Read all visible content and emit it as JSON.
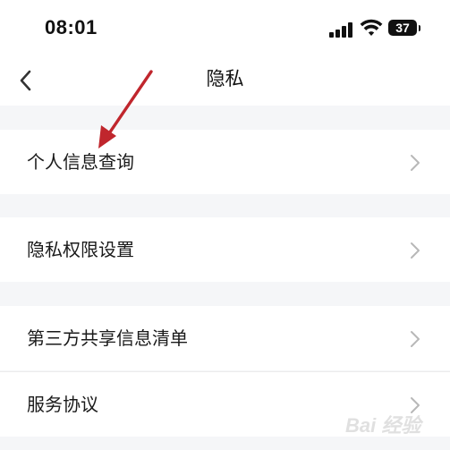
{
  "status_bar": {
    "time": "08:01",
    "battery_level": "37",
    "icons": [
      "signal-icon",
      "wifi-icon",
      "battery-icon"
    ]
  },
  "nav": {
    "title": "隐私",
    "back_icon": "chevron-left-icon"
  },
  "menu": {
    "items": [
      {
        "label": "个人信息查询",
        "icon": "chevron-right-icon"
      },
      {
        "label": "隐私权限设置",
        "icon": "chevron-right-icon"
      },
      {
        "label": "第三方共享信息清单",
        "icon": "chevron-right-icon"
      },
      {
        "label": "服务协议",
        "icon": "chevron-right-icon"
      }
    ]
  },
  "annotation": {
    "type": "arrow",
    "color": "#c0262d",
    "points_to": "个人信息查询"
  },
  "watermark": {
    "text": "Bai 经验"
  },
  "colors": {
    "background": "#f5f6f8",
    "surface": "#ffffff",
    "chevron": "#b8b8b8",
    "text": "#1a1a1a"
  }
}
